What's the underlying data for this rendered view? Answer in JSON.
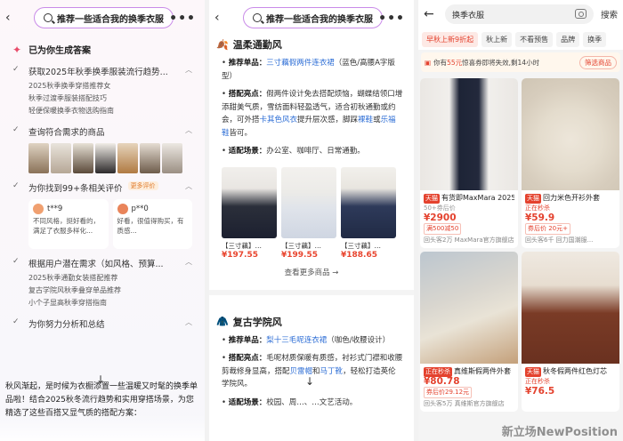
{
  "search_query": "推荐一些适合我的换季衣服",
  "panel1": {
    "answered": "已为你生成答案",
    "steps": [
      {
        "text": "获取2025年秋季换季服装流行趋势...",
        "subs": [
          "2025秋季换季穿搭推荐女",
          "秋季过渡季服装搭配技巧",
          "轻便保暖换季衣物选购指南"
        ]
      },
      {
        "text": "查询符合需求的商品"
      },
      {
        "text": "为你找到99+条相关评价",
        "tag": "更多评价"
      },
      {
        "text": "根据用户潜在需求（如风格、预算...",
        "subs": [
          "2025秋季通勤女装搭配推荐",
          "复古学院风秋季叠穿单品推荐",
          "小个子显高秋季穿搭指南"
        ]
      },
      {
        "text": "为你努力分析和总结"
      }
    ],
    "reviews": [
      {
        "user": "t**9",
        "text": "不同风格，挺好看的，满足了衣服多样化..."
      },
      {
        "user": "p**0",
        "text": "好看，很值得购买，有质感..."
      }
    ],
    "summary": "秋风渐起，是时候为衣橱添置一些温暖又时髦的换季单品啦！结合2025秋冬流行趋势和实用穿搭场景，为您精选了这些百搭又显气质的搭配方案："
  },
  "panel2": {
    "sec1": {
      "title": "温柔通勤风",
      "icon": "🍂",
      "item_label": "推荐单品：",
      "item": "三寸藕假两件连衣裙",
      "item_note": "（蓝色/高腰A字版型）",
      "hl_label": "搭配亮点：",
      "hl_text": "假两件设计免去搭配烦恼，蝴蝶结领口增添甜美气质，雪纺面料轻盈透气，适合初秋通勤或约会，可外搭",
      "hl_link1": "卡其色风衣",
      "hl_mid": "提升层次感，脚踩",
      "hl_link2": "裸鞋",
      "hl_or": "或",
      "hl_link3": "乐福鞋",
      "hl_end": "皆可。",
      "scene_label": "适配场景：",
      "scene": "办公室、咖啡厅、日常通勤。"
    },
    "products": [
      {
        "name": "【三寸藕】…",
        "price": "¥197.55"
      },
      {
        "name": "【三寸藕】…",
        "price": "¥199.55"
      },
      {
        "name": "【三寸藕】…",
        "price": "¥188.65"
      }
    ],
    "more": "查看更多商品 →",
    "sec2": {
      "title": "复古学院风",
      "icon": "🧥",
      "item_label": "推荐单品：",
      "item": "梨十三毛呢连衣裙",
      "item_note": "（咖色/收腰设计）",
      "hl_label": "搭配亮点：",
      "hl_text": "毛呢材质保暖有质感，衬衫式门襟和收腰剪裁修身显高，搭配",
      "hl_link1": "贝雷帽",
      "hl_mid": "和",
      "hl_link2": "马丁靴",
      "hl_end": "，轻松打造英伦学院风。",
      "scene_label": "适配场景：",
      "scene": "校园、周…、…文艺活动。"
    }
  },
  "panel3": {
    "search": "换季衣服",
    "search_btn": "搜索",
    "chips": [
      "早秋上新9折起",
      "秋上新",
      "不看预售",
      "品牌",
      "换季"
    ],
    "notice_pre": "你有",
    "notice_amt": "55元",
    "notice_post": "惊喜券即将失效,剩14小时",
    "notice_btn": "筛选商品",
    "products": [
      {
        "badge": "天猫",
        "title": "有货即MaxMara 2025",
        "sales": "50+券后价",
        "price": "¥2900",
        "promo": "满500减50",
        "shop": "回头客2万 MaxMara官方旗舰店"
      },
      {
        "badge": "天猫",
        "title": "回力米色开衫外套",
        "sales": "正在秒杀",
        "price": "¥59.9",
        "promo": "券后价 20元+",
        "shop": "回头客6千 回力国潮服..."
      },
      {
        "badge": "正在秒杀",
        "title": "真维斯假两件外套",
        "sales": "",
        "price": "¥80.78",
        "promo": "券后价29.12元",
        "shop": "回头客5万 真维斯官方旗舰店"
      },
      {
        "badge": "天猫",
        "title": "秋冬假两件红色灯芯",
        "sales": "正在秒杀",
        "price": "¥76.5",
        "promo": "券后价",
        "shop": "..."
      }
    ]
  },
  "watermark": "新立场NewPosition"
}
